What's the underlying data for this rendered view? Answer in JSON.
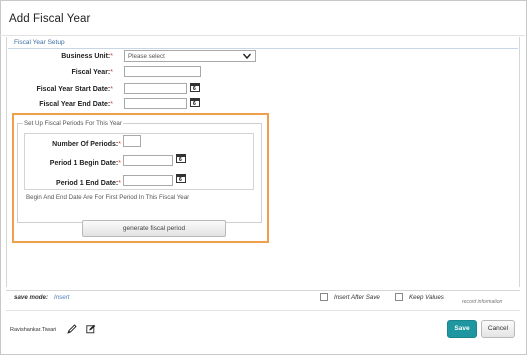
{
  "dialog": {
    "title": "Add Fiscal Year"
  },
  "section": {
    "title": "Fiscal Year Setup"
  },
  "form": {
    "business_unit": {
      "label": "Business Unit:",
      "required": "*",
      "selected": "Please select"
    },
    "fiscal_year": {
      "label": "Fiscal Year:",
      "required": "*",
      "value": ""
    },
    "start_date": {
      "label": "Fiscal Year Start Date:",
      "required": "*",
      "value": ""
    },
    "end_date": {
      "label": "Fiscal Year End Date:",
      "required": "*",
      "value": ""
    }
  },
  "periods": {
    "legend": "Set Up Fiscal Periods For This Year",
    "count": {
      "label": "Number Of Periods:",
      "required": "*",
      "value": ""
    },
    "begin": {
      "label": "Period 1 Begin Date:",
      "required": "*",
      "value": ""
    },
    "end": {
      "label": "Period 1 End Date:",
      "required": "*",
      "value": ""
    },
    "hint": "Begin And End Date Are For First Period In This Fiscal Year",
    "generate_label": "generate fiscal period"
  },
  "calendar_glyph": "6",
  "footer": {
    "save_mode_label": "save mode:",
    "save_mode_value": "Insert",
    "insert_after_save": "Insert After Save",
    "keep_values": "Keep Values",
    "record_information": "record information",
    "user": "Ravishankar.Tiwari",
    "save_label": "Save",
    "cancel_label": "Cancel"
  },
  "colors": {
    "accent": "#1f97a1",
    "highlight": "#f0a04b",
    "required": "#d23b3b",
    "section_title": "#3c6ea6"
  }
}
